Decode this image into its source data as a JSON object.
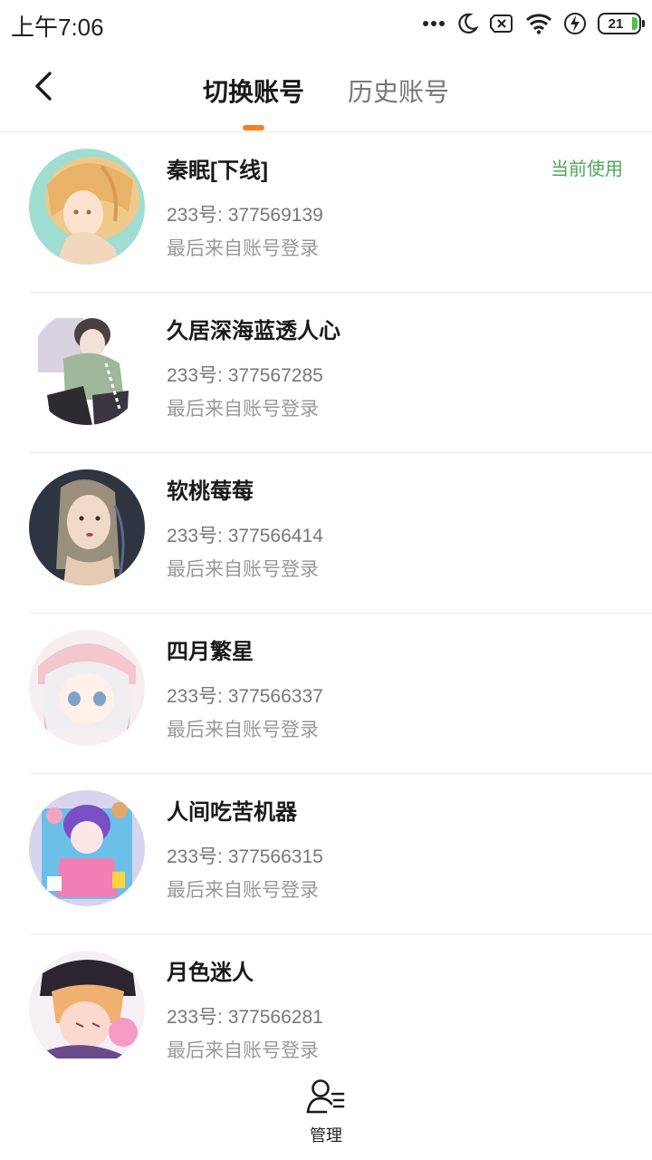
{
  "status_bar": {
    "time": "上午7:06",
    "battery_level": "21",
    "icons": [
      "more-dots-icon",
      "moon-icon",
      "no-sim-icon",
      "wifi-icon",
      "charging-icon",
      "battery-icon"
    ]
  },
  "header": {
    "back_icon": "chevron-left-icon",
    "tabs": [
      {
        "label": "切换账号",
        "active": true
      },
      {
        "label": "历史账号",
        "active": false
      }
    ],
    "accent_color": "#f5821f"
  },
  "accounts": [
    {
      "name": "秦眠[下线]",
      "id": "233号: 377569139",
      "login": "最后来自账号登录",
      "badge": "当前使用"
    },
    {
      "name": "久居深海蓝透人心",
      "id": "233号: 377567285",
      "login": "最后来自账号登录"
    },
    {
      "name": "软桃莓莓",
      "id": "233号: 377566414",
      "login": "最后来自账号登录"
    },
    {
      "name": "四月繁星",
      "id": "233号: 377566337",
      "login": "最后来自账号登录"
    },
    {
      "name": "人间吃苦机器",
      "id": "233号: 377566315",
      "login": "最后来自账号登录"
    },
    {
      "name": "月色迷人",
      "id": "233号: 377566281",
      "login": "最后来自账号登录"
    }
  ],
  "badge_color": "#4fa85a",
  "bottom_bar": {
    "manage_label": "管理",
    "manage_icon": "user-list-icon"
  }
}
